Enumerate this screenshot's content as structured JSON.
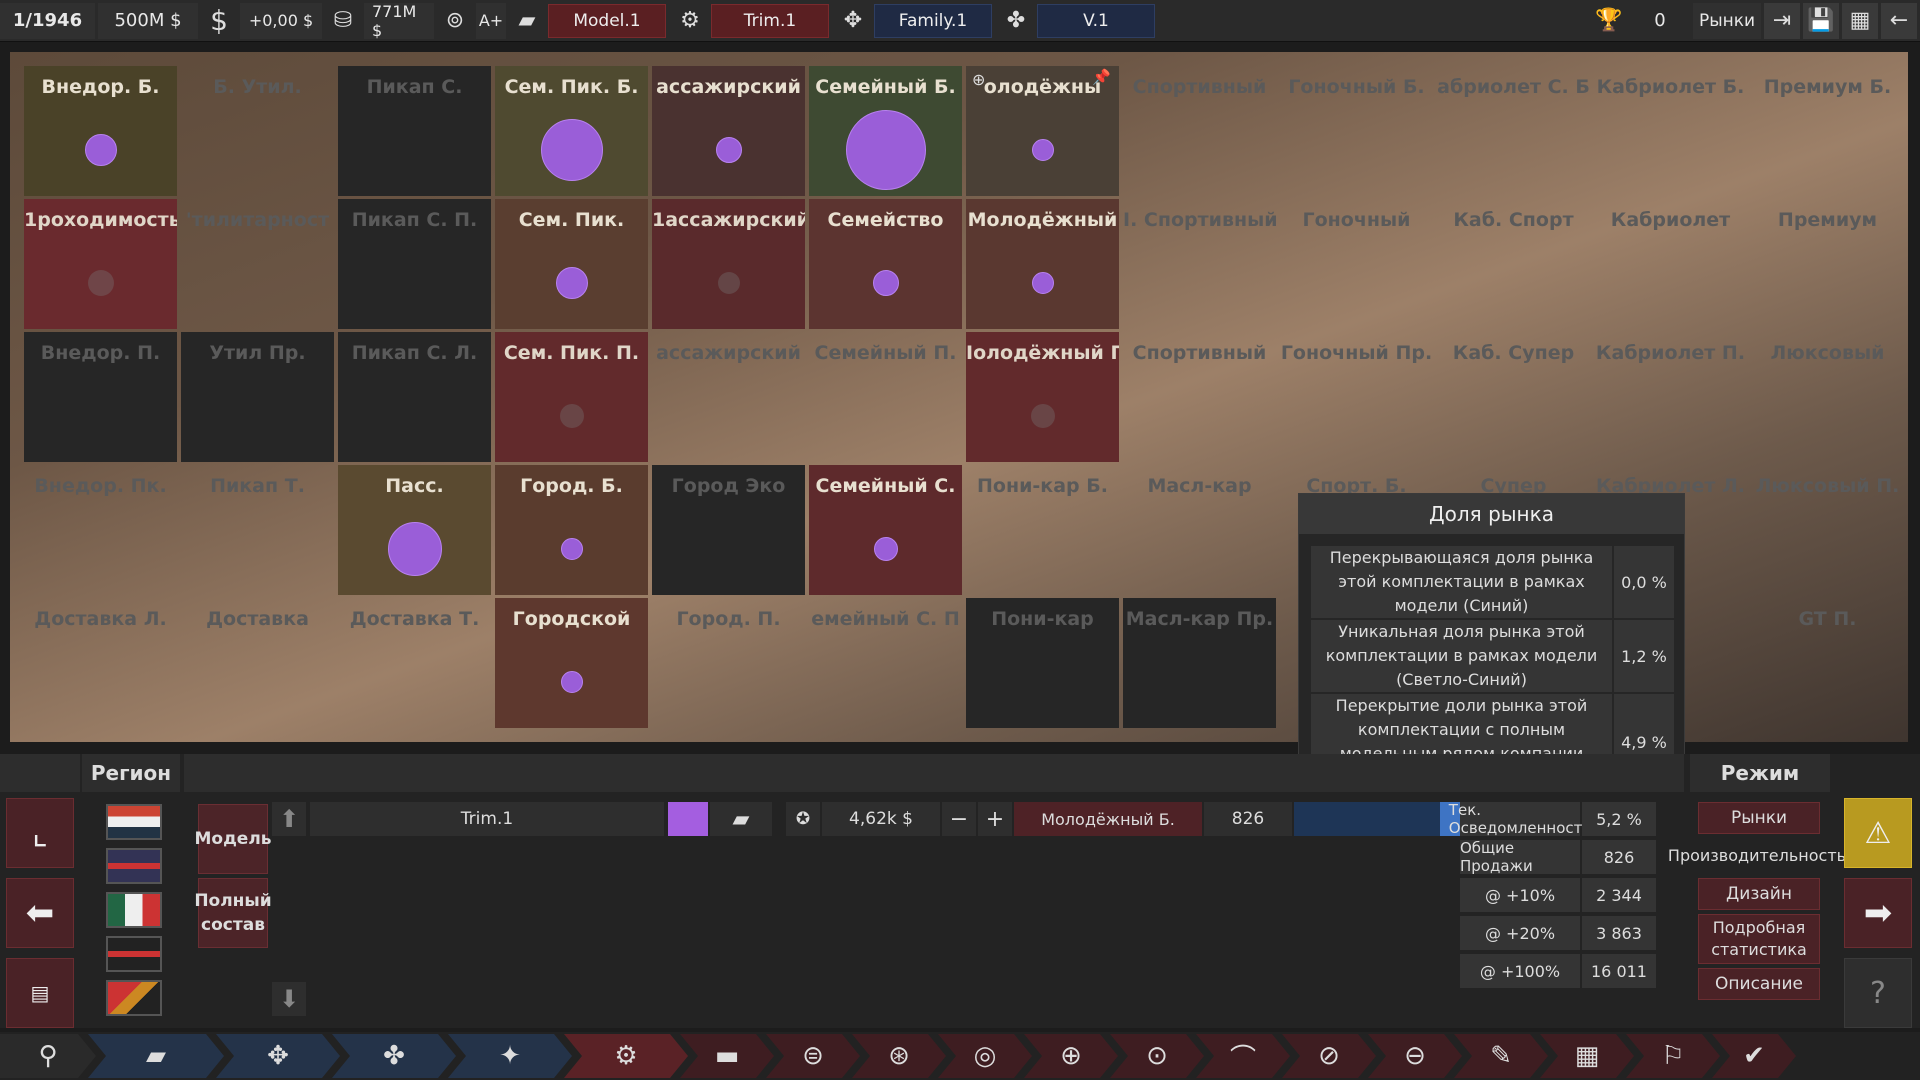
{
  "topbar": {
    "date": "1/1946",
    "money": "500M $",
    "dollar_icon": "$",
    "income": "+0,00 $",
    "loan_value": "771M $",
    "rating": "A+",
    "model_name": "Model.1",
    "trim_name": "Trim.1",
    "family_name": "Family.1",
    "version": "V.1",
    "trophy_count": "0",
    "markets_label": "Рынки",
    "icons": [
      "calendar-icon",
      "money-icon",
      "income-icon",
      "engine-icon",
      "loan-icon",
      "rating-icon",
      "car-icon",
      "trim-icon",
      "family-icon",
      "engine-family-icon",
      "trophy-icon",
      "exit-icon",
      "save-icon",
      "stats-icon",
      "back-icon"
    ]
  },
  "grid": {
    "rows": [
      [
        {
          "label": "Внедор. Б.",
          "state": "active",
          "bg": "#4a4228",
          "dot": 32
        },
        {
          "label": "Б. Утил.",
          "state": "none"
        },
        {
          "label": "Пикап С.",
          "state": "empty"
        },
        {
          "label": "Сем. Пик. Б.",
          "state": "active",
          "bg": "#4f4a30",
          "dot": 62
        },
        {
          "label": "ассажирский",
          "state": "active",
          "bg": "#4a3230",
          "dot": 26
        },
        {
          "label": "Семейный Б.",
          "state": "active",
          "bg": "#3e4a32",
          "dot": 80
        },
        {
          "label": "олодёжны",
          "state": "active",
          "bg": "#4a4036",
          "dot": 22,
          "pins": true
        },
        {
          "label": "Спортивный",
          "state": "none"
        },
        {
          "label": "Гоночный Б.",
          "state": "none"
        },
        {
          "label": "абриолет С. Б",
          "state": "none"
        },
        {
          "label": "Кабриолет Б.",
          "state": "none"
        },
        {
          "label": "Премиум Б.",
          "state": "none"
        }
      ],
      [
        {
          "label": "1роходимость",
          "state": "dim",
          "bg": "#6a2a2e",
          "dot": 26
        },
        {
          "label": "'тилитарност",
          "state": "none"
        },
        {
          "label": "Пикап С. П.",
          "state": "empty"
        },
        {
          "label": "Сем. Пик.",
          "state": "active",
          "bg": "#5a3e30",
          "dot": 32
        },
        {
          "label": "1ассажирский",
          "state": "dim",
          "bg": "#5a2a2c",
          "dot": 22
        },
        {
          "label": "Семейство",
          "state": "active",
          "bg": "#5c3430",
          "dot": 26
        },
        {
          "label": "Молодёжный",
          "state": "active",
          "bg": "#5a3830",
          "dot": 22
        },
        {
          "label": "I. Спортивный",
          "state": "none"
        },
        {
          "label": "Гоночный",
          "state": "none"
        },
        {
          "label": "Каб. Спорт",
          "state": "none"
        },
        {
          "label": "Кабриолет",
          "state": "none"
        },
        {
          "label": "Премиум",
          "state": "none"
        }
      ],
      [
        {
          "label": "Внедор. П.",
          "state": "empty"
        },
        {
          "label": "Утил Пр.",
          "state": "empty"
        },
        {
          "label": "Пикап С. Л.",
          "state": "empty"
        },
        {
          "label": "Сем. Пик. П.",
          "state": "dim",
          "bg": "#622a2c",
          "dot": 24
        },
        {
          "label": "ассажирский",
          "state": "none"
        },
        {
          "label": "Семейный П.",
          "state": "none"
        },
        {
          "label": "Iолодёжный Г",
          "state": "dim",
          "bg": "#622a2c",
          "dot": 24
        },
        {
          "label": "Спортивный",
          "state": "none"
        },
        {
          "label": "Гоночный Пр.",
          "state": "none"
        },
        {
          "label": "Каб. Супер",
          "state": "none"
        },
        {
          "label": "Кабриолет П.",
          "state": "none"
        },
        {
          "label": "Люксовый",
          "state": "none"
        }
      ],
      [
        {
          "label": "Внедор. Пк.",
          "state": "none"
        },
        {
          "label": "Пикап Т.",
          "state": "none"
        },
        {
          "label": "Пасс.",
          "state": "active",
          "bg": "#5a4a30",
          "dot": 54
        },
        {
          "label": "Город. Б.",
          "state": "active",
          "bg": "#5a3c2e",
          "dot": 22
        },
        {
          "label": "Город Эко",
          "state": "empty"
        },
        {
          "label": "Семейный С.",
          "state": "active",
          "bg": "#5e2a2c",
          "dot": 24
        },
        {
          "label": "Пони-кар Б.",
          "state": "none"
        },
        {
          "label": "Масл-кар",
          "state": "none"
        },
        {
          "label": "Спорт. Б.",
          "state": "none"
        },
        {
          "label": "Супер",
          "state": "none"
        },
        {
          "label": "Кабриолет Л.",
          "state": "none"
        },
        {
          "label": "Люксовый П.",
          "state": "none"
        }
      ],
      [
        {
          "label": "Доставка Л.",
          "state": "none"
        },
        {
          "label": "Доставка",
          "state": "none"
        },
        {
          "label": "Доставка Т.",
          "state": "none"
        },
        {
          "label": "Городской",
          "state": "active",
          "bg": "#5e382e",
          "dot": 22
        },
        {
          "label": "Город. П.",
          "state": "none"
        },
        {
          "label": "емейный С. П",
          "state": "none"
        },
        {
          "label": "Пони-кар",
          "state": "empty"
        },
        {
          "label": "Масл-кар Пр.",
          "state": "empty"
        },
        {
          "label": "С",
          "state": "none"
        },
        {
          "label": "",
          "state": "none"
        },
        {
          "label": "",
          "state": "none"
        },
        {
          "label": "GT П.",
          "state": "none"
        }
      ]
    ]
  },
  "market_share": {
    "title": "Доля рынка",
    "rows": [
      {
        "text": "Перекрывающаяся доля рынка этой комплектации в рамках модели (Синий)",
        "value": "0,0 %"
      },
      {
        "text": "Уникальная доля рынка этой комплектации в рамках модели (Светло-Синий)",
        "value": "1,2 %"
      },
      {
        "text": "Перекрытие доли рынка этой комплектации с полным модельным рядом компании (Темно-Синий)",
        "value": "4,9 %"
      }
    ]
  },
  "bottom": {
    "region_label": "Регион",
    "mode_label": "Режим",
    "model_btn": "Модель",
    "full_lineup_btn": "Полный состав",
    "trim_name": "Trim.1",
    "trim_color": "#a45ee0",
    "price": "4,62k $",
    "minus": "−",
    "plus": "+",
    "market_name": "Молодёжный Б.",
    "sales_value": "826",
    "awareness_label": "Тек. Осведомленность",
    "awareness_value": "5,2 %",
    "total_sales_label": "Общие Продажи",
    "total_sales_value": "826",
    "p10_label": "@ +10%",
    "p10_value": "2 344",
    "p20_label": "@ +20%",
    "p20_value": "3 863",
    "p100_label": "@ +100%",
    "p100_value": "16 011",
    "mode_buttons": {
      "markets": "Рынки",
      "production": "Производительность",
      "design": "Дизайн",
      "detailed": "Подробная статистика",
      "description": "Описание"
    }
  },
  "tabs": [
    "trim-icon",
    "car-body-icon",
    "engine-family-icon",
    "engine-icon",
    "engine-tuning-icon",
    "trim-select-icon",
    "chassis-icon",
    "suspension-icon",
    "drivetrain-icon",
    "brakes-icon",
    "wheels-icon",
    "tires-icon",
    "aero-icon",
    "interior-icon",
    "safety-icon",
    "paint-icon",
    "calculator-icon",
    "test-track-icon",
    "done-icon"
  ]
}
